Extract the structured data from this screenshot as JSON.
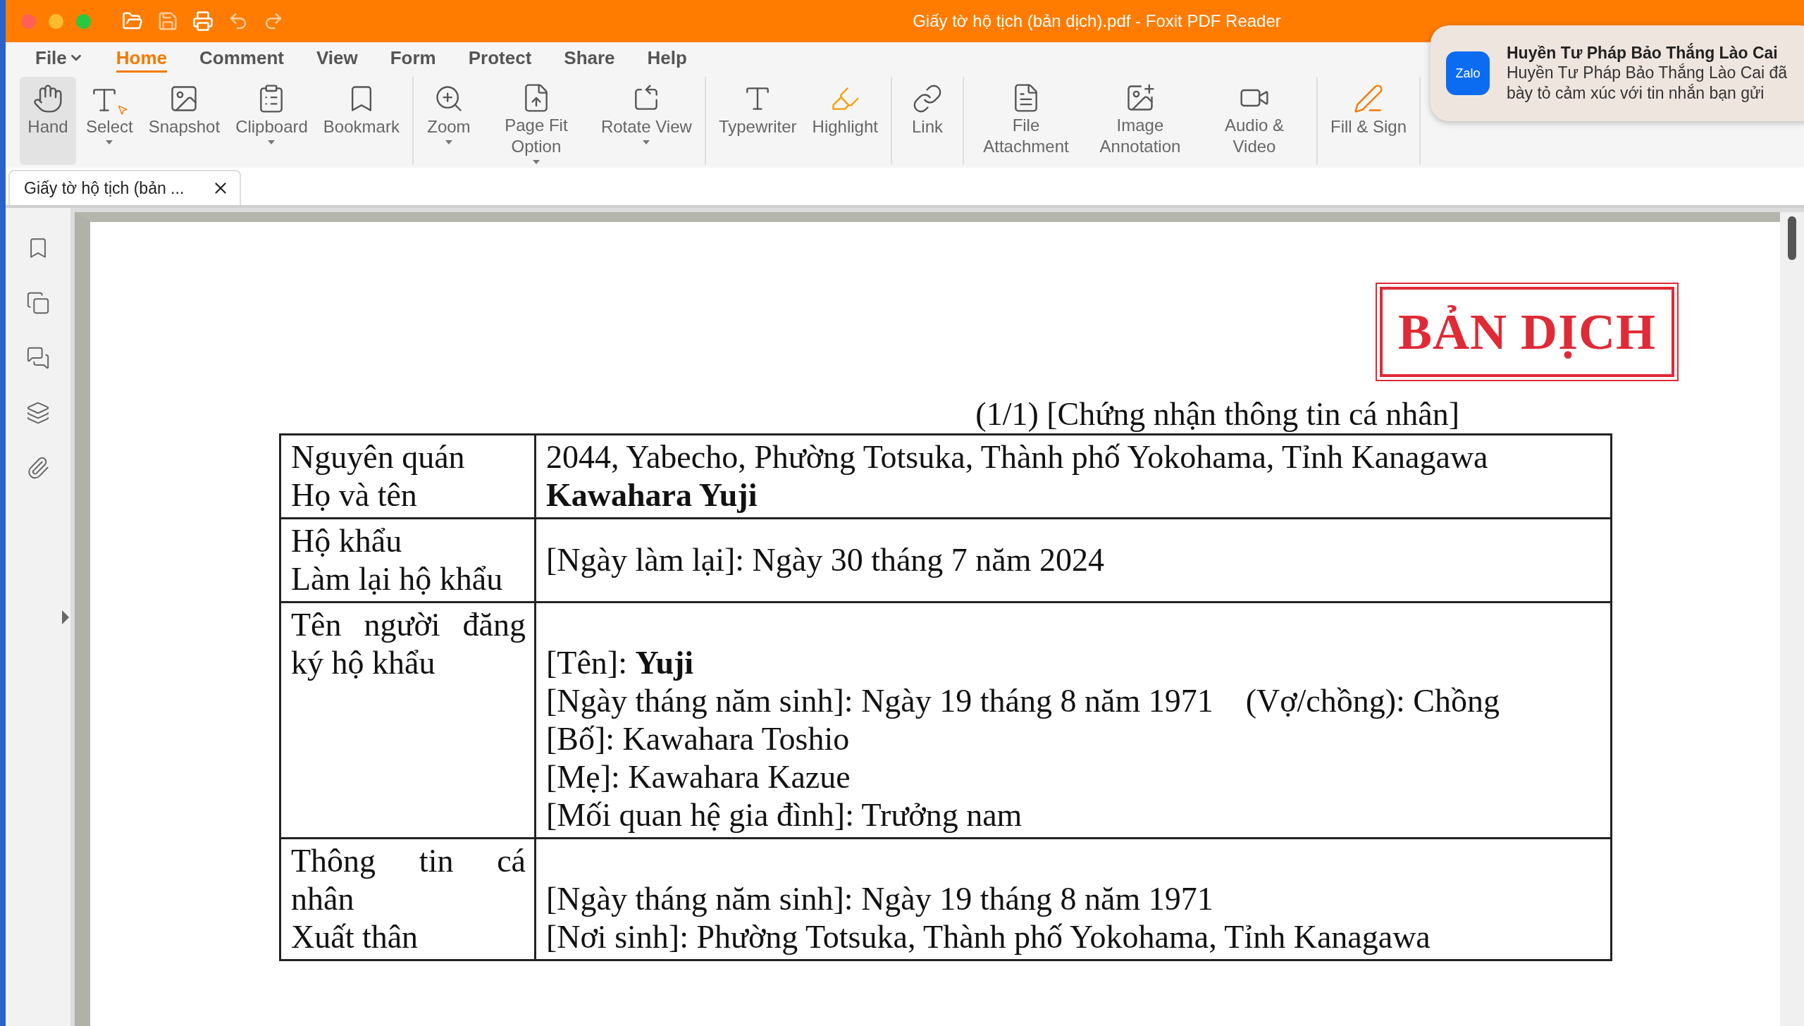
{
  "window": {
    "title": "Giấy tờ hộ tịch (bản dịch).pdf - Foxit PDF Reader"
  },
  "menu": [
    {
      "label": "File",
      "selected": false,
      "dropdown": true
    },
    {
      "label": "Home",
      "selected": true,
      "dropdown": false
    },
    {
      "label": "Comment",
      "selected": false,
      "dropdown": false
    },
    {
      "label": "View",
      "selected": false,
      "dropdown": false
    },
    {
      "label": "Form",
      "selected": false,
      "dropdown": false
    },
    {
      "label": "Protect",
      "selected": false,
      "dropdown": false
    },
    {
      "label": "Share",
      "selected": false,
      "dropdown": false
    },
    {
      "label": "Help",
      "selected": false,
      "dropdown": false
    }
  ],
  "ribbon": {
    "groups": [
      [
        {
          "label": "Hand",
          "selected": true,
          "dropdown": false
        },
        {
          "label": "Select",
          "selected": false,
          "dropdown": true
        },
        {
          "label": "Snapshot",
          "selected": false,
          "dropdown": false
        },
        {
          "label": "Clipboard",
          "selected": false,
          "dropdown": true
        },
        {
          "label": "Bookmark",
          "selected": false,
          "dropdown": false
        }
      ],
      [
        {
          "label": "Zoom",
          "selected": false,
          "dropdown": true
        },
        {
          "label": "Page Fit Option",
          "selected": false,
          "dropdown": true
        },
        {
          "label": "Rotate View",
          "selected": false,
          "dropdown": true
        }
      ],
      [
        {
          "label": "Typewriter",
          "selected": false,
          "dropdown": false
        },
        {
          "label": "Highlight",
          "selected": false,
          "dropdown": false
        }
      ],
      [
        {
          "label": "Link",
          "selected": false,
          "dropdown": false
        }
      ],
      [
        {
          "label": "File Attachment",
          "selected": false,
          "dropdown": false
        },
        {
          "label": "Image Annotation",
          "selected": false,
          "dropdown": false
        },
        {
          "label": "Audio & Video",
          "selected": false,
          "dropdown": false
        }
      ],
      [
        {
          "label": "Fill & Sign",
          "selected": false,
          "dropdown": false
        }
      ]
    ]
  },
  "doc_tabs": [
    {
      "title": "Giấy tờ hộ tịch (bản ...",
      "selected": true
    }
  ],
  "notification": {
    "app_logo": "Zalo",
    "title": "Huyền Tư Pháp Bảo Thắng Lào Cai",
    "message": "Huyền Tư Pháp Bảo Thắng Lào Cai đã bày tỏ cảm xúc với tin nhắn bạn gửi"
  },
  "document": {
    "stamp": "BẢN DỊCH",
    "heading": "(1/1) [Chứng nhận thông tin cá nhân]",
    "rows": [
      {
        "label": [
          "Nguyên quán",
          "Họ và tên"
        ],
        "values": [
          {
            "text": "2044, Yabecho, Phường Totsuka, Thành phố Yokohama, Tỉnh Kanagawa"
          },
          {
            "text": "**Kawahara Yuji**"
          }
        ]
      },
      {
        "label": [
          "Hộ khẩu",
          "Làm lại hộ khẩu"
        ],
        "values": [
          {
            "text": "[Ngày làm lại]: Ngày 30 tháng 7 năm 2024"
          }
        ]
      },
      {
        "label": [
          "Tên người đăng ký hộ khẩu"
        ],
        "values": [
          {
            "text": "[Tên]: **Yuji**"
          },
          {
            "text": "[Ngày tháng năm sinh]: Ngày 19 tháng 8 năm 1971",
            "aside": "(Vợ/chồng): Chồng"
          },
          {
            "text": "[Bố]: Kawahara Toshio"
          },
          {
            "text": "[Mẹ]: Kawahara Kazue"
          },
          {
            "text": "[Mối quan hệ gia đình]: Trưởng nam"
          }
        ]
      },
      {
        "label": [
          "Thông tin cá nhân",
          "Xuất thân"
        ],
        "values": [
          {
            "text": "[Ngày tháng năm sinh]: Ngày 19 tháng 8 năm 1971"
          },
          {
            "text": "[Nơi sinh]: Phường Totsuka, Thành phố Yokohama, Tỉnh Kanagawa"
          }
        ]
      }
    ]
  }
}
